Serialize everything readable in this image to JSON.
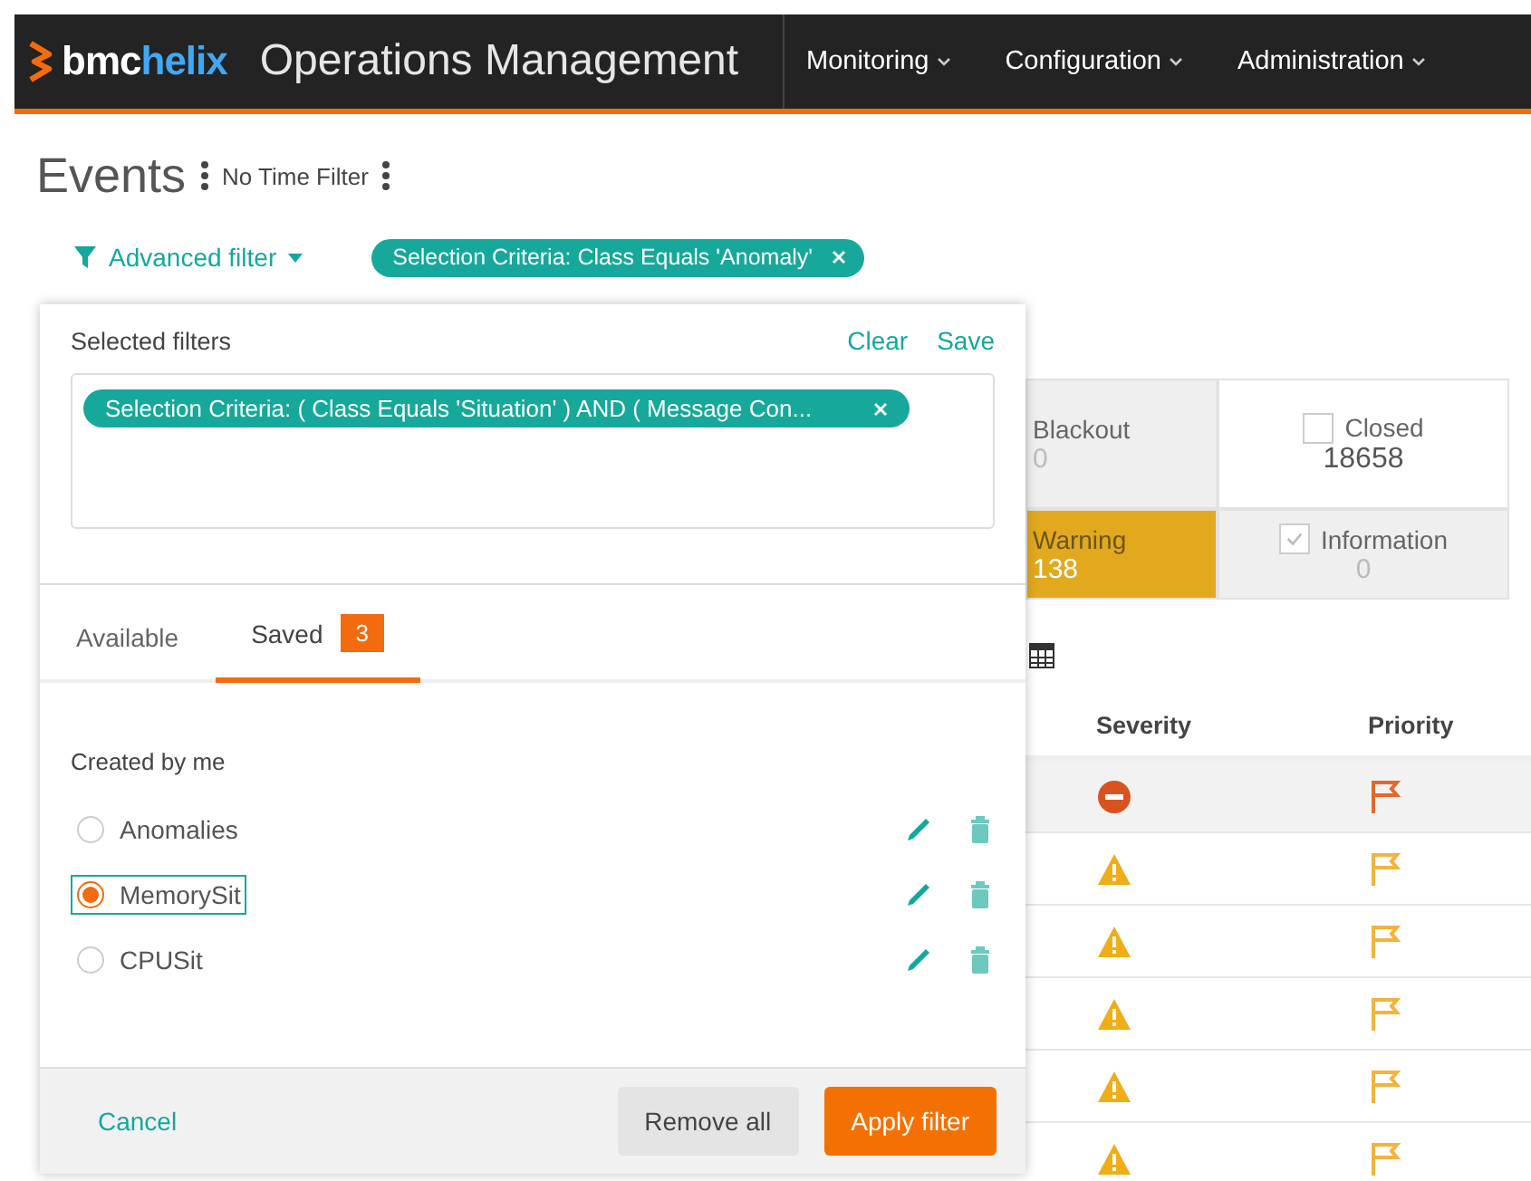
{
  "header": {
    "brand": "bmc",
    "brand_accent": "helix",
    "product": "Operations Management",
    "nav": [
      {
        "label": "Monitoring"
      },
      {
        "label": "Configuration"
      },
      {
        "label": "Administration"
      }
    ]
  },
  "page": {
    "title": "Events",
    "time_filter": "No Time Filter"
  },
  "filter_bar": {
    "advanced_filter": "Advanced filter",
    "chips": [
      "Selection Criteria: Class Equals 'Anomaly'"
    ]
  },
  "status_tiles": [
    {
      "label": "Blackout",
      "count": "0",
      "kind": "plain",
      "color": "#efefef"
    },
    {
      "label": "Closed",
      "count": "18658",
      "kind": "checkbox",
      "checked": false,
      "color": "#ffffff"
    },
    {
      "label": "Warning",
      "count": "138",
      "kind": "plain",
      "color": "#e2a91f"
    },
    {
      "label": "Information",
      "count": "0",
      "kind": "checkbox",
      "checked": true,
      "color": "#efefef"
    }
  ],
  "table": {
    "columns": [
      "Severity",
      "Priority"
    ],
    "rows": [
      {
        "selected": true,
        "cells": [
          {
            "kind": "critical"
          },
          {
            "kind": "flag",
            "color": "#e06a2c"
          }
        ]
      },
      {
        "selected": false,
        "cells": [
          {
            "kind": "warning"
          },
          {
            "kind": "flag",
            "color": "#f3b33d"
          }
        ]
      },
      {
        "selected": false,
        "cells": [
          {
            "kind": "warning"
          },
          {
            "kind": "flag",
            "color": "#f3b33d"
          }
        ]
      },
      {
        "selected": false,
        "cells": [
          {
            "kind": "warning"
          },
          {
            "kind": "flag",
            "color": "#f3b33d"
          }
        ]
      },
      {
        "selected": false,
        "cells": [
          {
            "kind": "warning"
          },
          {
            "kind": "flag",
            "color": "#f3b33d"
          }
        ]
      },
      {
        "selected": false,
        "cells": [
          {
            "kind": "warning"
          },
          {
            "kind": "flag",
            "color": "#f3b33d"
          }
        ]
      }
    ]
  },
  "filter_panel": {
    "title": "Selected filters",
    "actions": [
      "Clear",
      "Save"
    ],
    "chips": [
      "Selection Criteria: ( Class Equals 'Situation' ) AND ( Message Con..."
    ],
    "tabs": [
      {
        "label": "Available",
        "selected": false
      },
      {
        "label": "Saved",
        "selected": true,
        "badge": "3"
      }
    ],
    "group": "Created by me",
    "saved_filters": [
      {
        "name": "Anomalies",
        "selected": false
      },
      {
        "name": "MemorySit",
        "selected": true
      },
      {
        "name": "CPUSit",
        "selected": false
      }
    ],
    "footer": {
      "cancel": "Cancel",
      "remove_all": "Remove all",
      "apply": "Apply filter"
    }
  }
}
